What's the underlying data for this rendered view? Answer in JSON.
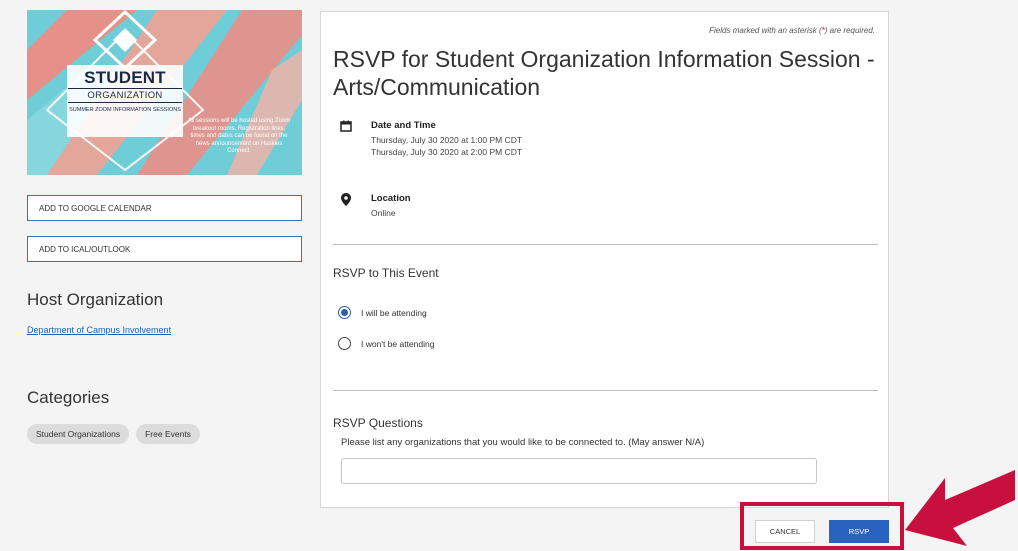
{
  "banner": {
    "title": "STUDENT",
    "org": "ORGANIZATION",
    "sub": "SUMMER ZOOM INFORMATION SESSIONS",
    "info": "All sessions will be hosted using Zoom breakout rooms. Registration links, times and dates can be found on the news announcement on Huskies Connect.",
    "colors": {
      "teal": "#6ecdd6",
      "coral": "#f28b82",
      "navy": "#1b2a44"
    }
  },
  "calendar": {
    "google_label": "ADD TO GOOGLE CALENDAR",
    "ical_label": "ADD TO ICAL/OUTLOOK"
  },
  "host": {
    "heading": "Host Organization",
    "link": "Department of Campus Involvement"
  },
  "categories": {
    "heading": "Categories",
    "chips": [
      "Student Organizations",
      "Free Events"
    ]
  },
  "event": {
    "required_note_pre": "Fields marked with an asterisk (",
    "required_note_ast": "*",
    "required_note_post": ") are required.",
    "title": "RSVP for Student Organization Information Session - Arts/Communication",
    "date_label": "Date and Time",
    "date_start": "Thursday, July 30 2020 at 1:00 PM CDT",
    "date_end": "Thursday, July 30 2020 at 2:00 PM CDT",
    "location_label": "Location",
    "location_value": "Online",
    "icons": [
      "calendar-icon",
      "location-pin-icon"
    ]
  },
  "rsvp": {
    "heading": "RSVP to This Event",
    "options": [
      "I will be attending",
      "I won't be attending"
    ],
    "selected": 0
  },
  "questions": {
    "heading": "RSVP Questions",
    "q1": "Please list any organizations that you would like to be connected to. (May answer N/A)",
    "q1_value": ""
  },
  "actions": {
    "cancel_label": "CANCEL",
    "rsvp_label": "RSVP",
    "accent": "#2a62c0",
    "highlight": "#c8103f"
  }
}
